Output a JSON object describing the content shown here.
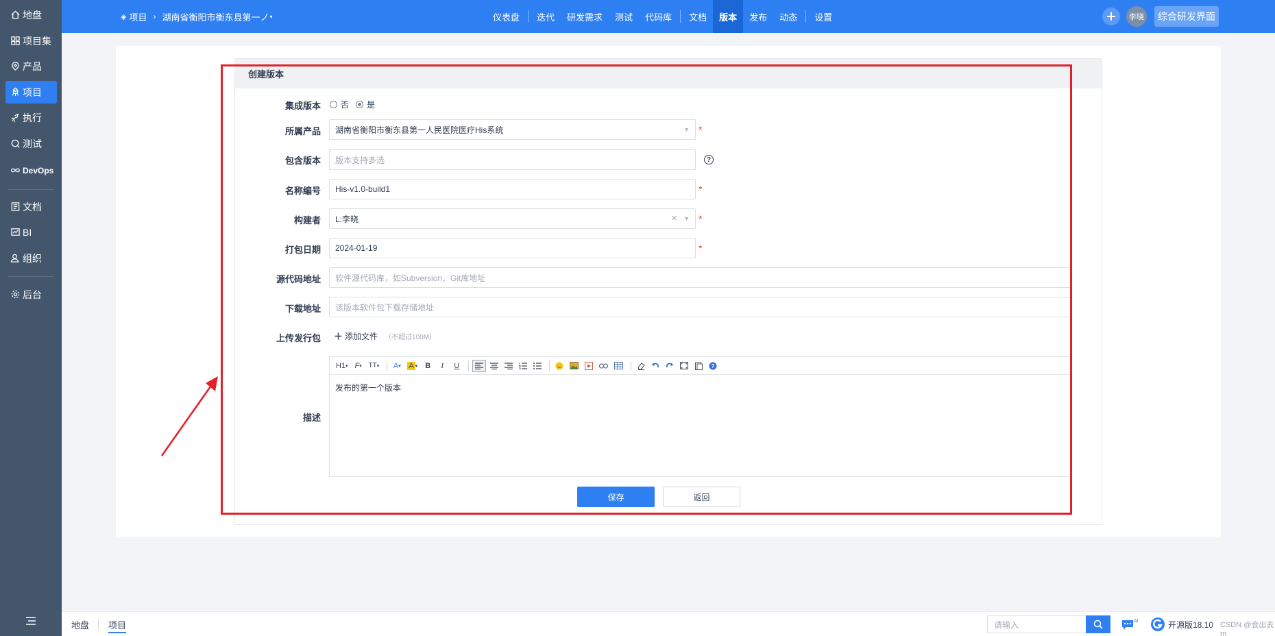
{
  "sidebar": {
    "items": [
      {
        "label": "地盘",
        "icon": "home-icon"
      },
      {
        "label": "项目集",
        "icon": "grid-icon"
      },
      {
        "label": "产品",
        "icon": "product-icon"
      },
      {
        "label": "项目",
        "icon": "project-icon"
      },
      {
        "label": "执行",
        "icon": "execute-icon"
      },
      {
        "label": "测试",
        "icon": "test-icon"
      },
      {
        "label": "DevOps",
        "icon": "infinity-icon"
      },
      {
        "label": "文档",
        "icon": "doc-icon"
      },
      {
        "label": "BI",
        "icon": "chart-icon"
      },
      {
        "label": "组织",
        "icon": "people-icon"
      },
      {
        "label": "后台",
        "icon": "gear-icon"
      }
    ],
    "active": "项目"
  },
  "header": {
    "breadcrumb_root": "项目",
    "project_name": "湖南省衡阳市衡东县第一ノ",
    "nav": [
      "仪表盘",
      "迭代",
      "研发需求",
      "测试",
      "代码库",
      "文档",
      "版本",
      "发布",
      "动态",
      "设置"
    ],
    "active_nav": "版本",
    "user_initials": "李晓",
    "view_button": "综合研发界面"
  },
  "form": {
    "title": "创建版本",
    "integrated": {
      "label": "集成版本",
      "options": [
        "否",
        "是"
      ],
      "selected": "是"
    },
    "product": {
      "label": "所属产品",
      "value": "湖南省衡阳市衡东县第一人民医院医疗His系统"
    },
    "included_builds": {
      "label": "包含版本",
      "placeholder": "版本支持多选"
    },
    "name": {
      "label": "名称编号",
      "value": "His-v1.0-build1"
    },
    "builder": {
      "label": "构建者",
      "value": "L:李晓"
    },
    "date": {
      "label": "打包日期",
      "value": "2024-01-19"
    },
    "scm_path": {
      "label": "源代码地址",
      "placeholder": "软件源代码库，如Subversion、Git库地址"
    },
    "file_path": {
      "label": "下载地址",
      "placeholder": "该版本软件包下载存储地址"
    },
    "upload": {
      "label": "上传发行包",
      "button": "添加文件",
      "hint": "（不超过100M）"
    },
    "description": {
      "label": "描述",
      "content": "发布的第一个版本"
    },
    "required_mark": "*",
    "save": "保存",
    "back": "返回"
  },
  "editor_toolbar": {
    "heading": "H1",
    "font": "F",
    "size": "TT",
    "color": "A",
    "bg": "A",
    "bold": "B",
    "italic": "I",
    "underline": "U"
  },
  "bottom": {
    "tabs": [
      "地盘",
      "项目"
    ],
    "active_tab": "项目",
    "search_placeholder": "请输入",
    "version": "开源版18.10",
    "watermark": "CSDN @会出去m"
  },
  "colors": {
    "primary": "#2e7ff2",
    "sidebar": "#43566b",
    "required": "#e33e33",
    "annotation": "#e3202a"
  }
}
